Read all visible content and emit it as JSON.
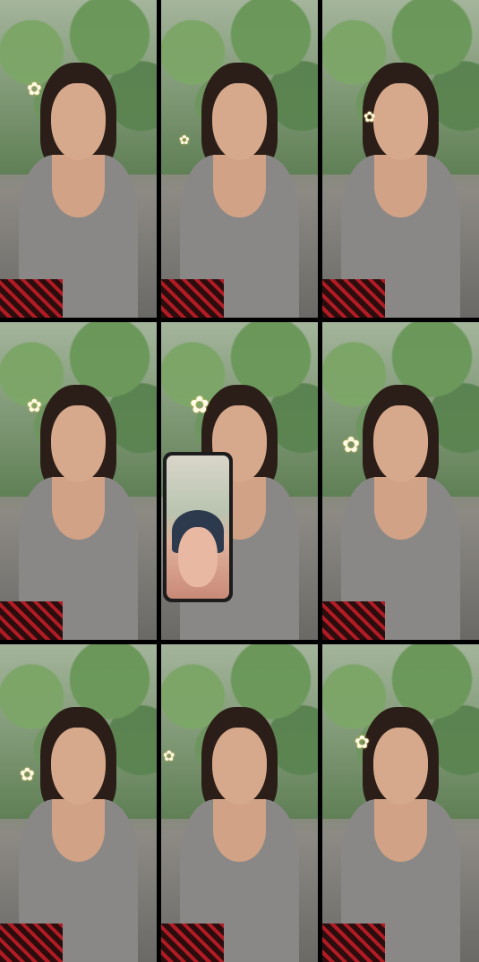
{
  "collage": {
    "rows": 3,
    "columns": 3,
    "tiles": [
      {
        "id": "tile-1",
        "flower": true
      },
      {
        "id": "tile-2",
        "flower": true
      },
      {
        "id": "tile-3",
        "flower": true
      },
      {
        "id": "tile-4",
        "flower": true
      },
      {
        "id": "tile-5",
        "flower": true,
        "phone_in_frame": true
      },
      {
        "id": "tile-6",
        "flower": true
      },
      {
        "id": "tile-7",
        "flower": true
      },
      {
        "id": "tile-8",
        "flower": true
      },
      {
        "id": "tile-9",
        "flower": true
      }
    ]
  },
  "colors": {
    "border": "#000000",
    "shirt": "#8a8886",
    "foliage": "#6f8a63"
  },
  "icons": {
    "flower": "frangipani-flower-icon",
    "phone": "smartphone-icon"
  }
}
